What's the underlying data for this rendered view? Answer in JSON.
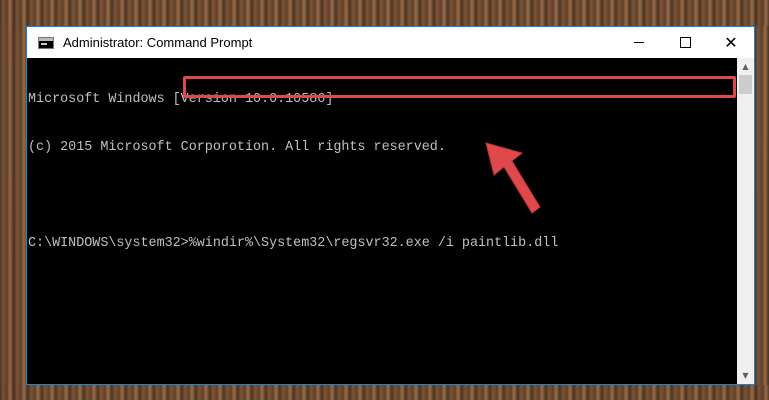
{
  "window": {
    "title": "Administrator: Command Prompt",
    "icon": "command-prompt-icon",
    "controls": {
      "minimize": "minimize-icon",
      "maximize": "maximize-icon",
      "close": "close-icon"
    }
  },
  "console": {
    "lines": [
      "Microsoft Windows [Version 10.0.10586]",
      "(c) 2015 Microsoft Corporotion. All rights reserved.",
      "",
      "C:\\WINDOWS\\system32>%windir%\\System32\\regsvr32.exe /i paintlib.dll"
    ]
  },
  "annotation": {
    "highlight_color": "#e0494b",
    "arrow_color": "#e0494b",
    "arrow_icon": "arrow-pointer-icon"
  },
  "scrollbar": {
    "up": "scroll-up-icon",
    "down": "scroll-down-icon"
  }
}
